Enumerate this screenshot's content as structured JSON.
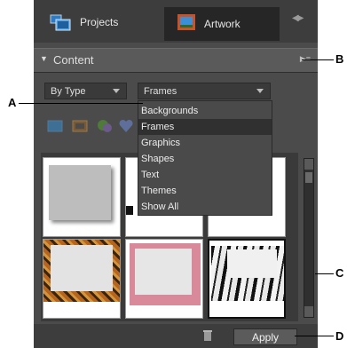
{
  "tabs": {
    "projects": "Projects",
    "artwork": "Artwork"
  },
  "content": {
    "title": "Content"
  },
  "filters": {
    "type_value": "By Type",
    "category_value": "Frames",
    "options": [
      "Backgrounds",
      "Frames",
      "Graphics",
      "Shapes",
      "Text",
      "Themes",
      "Show All"
    ],
    "selected_option": "Frames"
  },
  "footer": {
    "apply": "Apply"
  },
  "callouts": {
    "a": "A",
    "b": "B",
    "c": "C",
    "d": "D"
  },
  "colors": {
    "panel_bg": "#4b4b4b",
    "tab_bg": "#3d3d3d",
    "dropdown_bg": "#4a4a4a"
  }
}
